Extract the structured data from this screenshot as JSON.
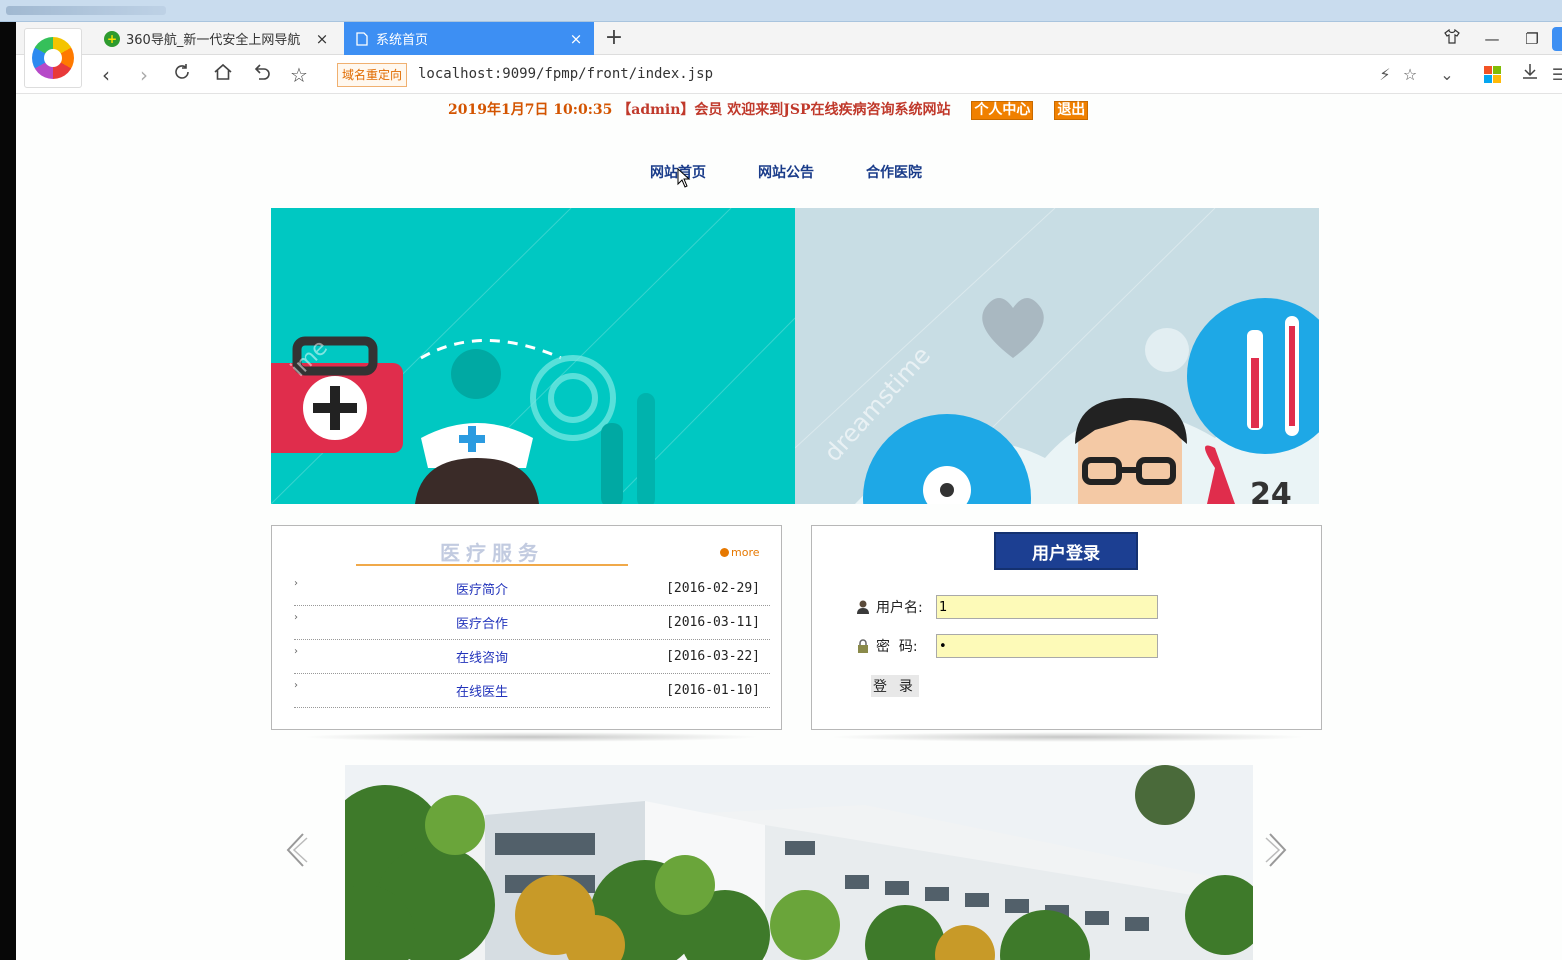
{
  "browser": {
    "tabs": [
      {
        "title": "360导航_新一代安全上网导航",
        "active": false
      },
      {
        "title": "系统首页",
        "active": true
      }
    ],
    "new_tab_label": "+",
    "redirect_badge": "域名重定向",
    "url": "localhost:9099/fpmp/front/index.jsp"
  },
  "header": {
    "datetime": "2019年1月7日 10:0:35",
    "welcome": "【admin】会员 欢迎来到JSP在线疾病咨询系统网站",
    "personal_center": "个人中心",
    "logout": "退出"
  },
  "nav": [
    {
      "label": "网站首页"
    },
    {
      "label": "网站公告"
    },
    {
      "label": "合作医院"
    }
  ],
  "banner": {
    "watermark": "dreamstime",
    "number": "24"
  },
  "services": {
    "title": "医疗服务",
    "more": "more",
    "items": [
      {
        "label": "医疗简介",
        "date": "[2016-02-29]"
      },
      {
        "label": "医疗合作",
        "date": "[2016-03-11]"
      },
      {
        "label": "在线咨询",
        "date": "[2016-03-22]"
      },
      {
        "label": "在线医生",
        "date": "[2016-01-10]"
      }
    ]
  },
  "login": {
    "title": "用户登录",
    "username_label": "用户名:",
    "username_value": "1",
    "password_label": "密  码:",
    "password_value": "•",
    "submit": "登 录"
  },
  "colors": {
    "accent_blue": "#3d8ff3",
    "header_red": "#c0392b",
    "orange": "#f08000",
    "nav_blue": "#1a3c8a",
    "login_blue": "#1c3f92",
    "banner_teal": "#00c8c2",
    "input_yellow": "#fdfab8"
  }
}
